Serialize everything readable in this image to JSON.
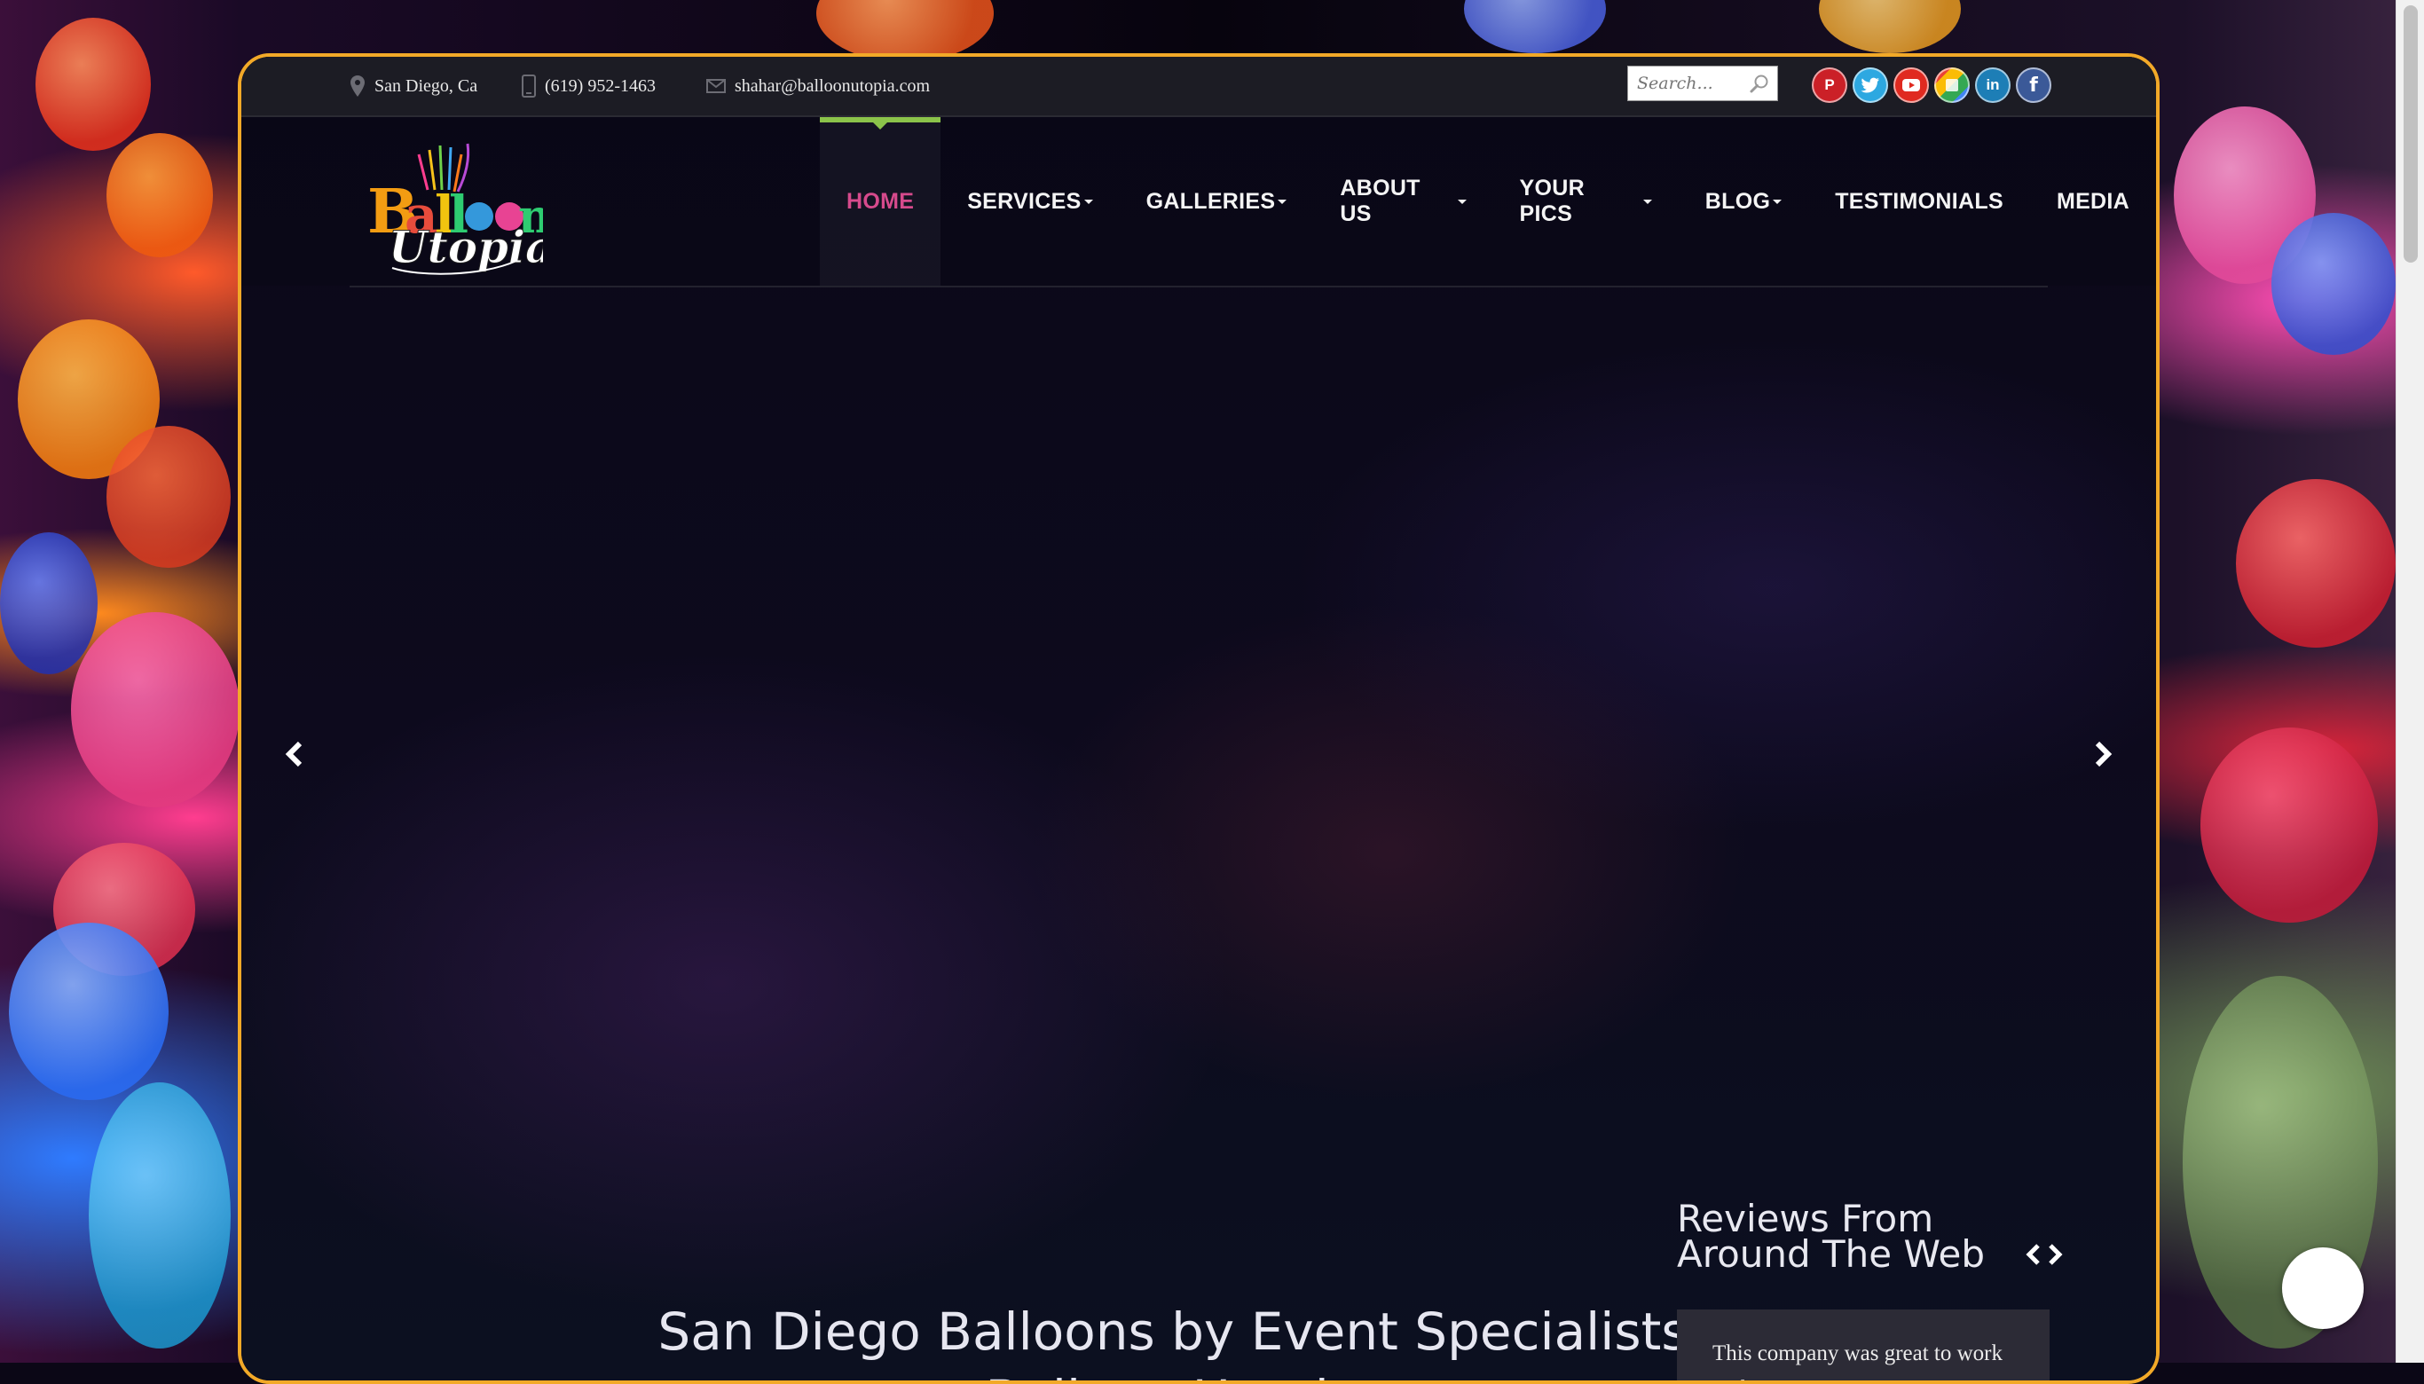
{
  "topbar": {
    "location": "San Diego, Ca",
    "phone": "(619) 952-1463",
    "email": "shahar@balloonutopia.com"
  },
  "search": {
    "placeholder": "Search..."
  },
  "socials": [
    {
      "name": "pinterest-icon",
      "color": "#cb2027"
    },
    {
      "name": "twitter-icon",
      "color": "#2da8e1"
    },
    {
      "name": "youtube-icon",
      "color": "#e02a20"
    },
    {
      "name": "google-photos-icon",
      "color": "#f4b400"
    },
    {
      "name": "linkedin-icon",
      "color": "#1d7eb6"
    },
    {
      "name": "facebook-icon",
      "color": "#3b5998"
    }
  ],
  "logo": {
    "line1": "Balloon",
    "line2": "Utopia"
  },
  "nav": {
    "items": [
      {
        "label": "HOME",
        "active": true,
        "dropdown": false
      },
      {
        "label": "SERVICES",
        "dropdown": true
      },
      {
        "label": "GALLERIES",
        "dropdown": true
      },
      {
        "label": "ABOUT US",
        "dropdown": true
      },
      {
        "label": "YOUR PICS",
        "dropdown": true
      },
      {
        "label": "BLOG",
        "dropdown": true
      },
      {
        "label": "TESTIMONIALS",
        "dropdown": false
      },
      {
        "label": "MEDIA",
        "dropdown": false
      }
    ]
  },
  "hero": {
    "line1": "San Diego Balloons by Event Specialists",
    "line2": "Balloon Utopia"
  },
  "reviews": {
    "title": "Reviews From Around The Web",
    "text": "This company was great to work with. My organization was"
  },
  "colors": {
    "frame_border": "#f2a928",
    "active_nav": "#d64a8c",
    "active_indicator": "#8bc34a"
  }
}
